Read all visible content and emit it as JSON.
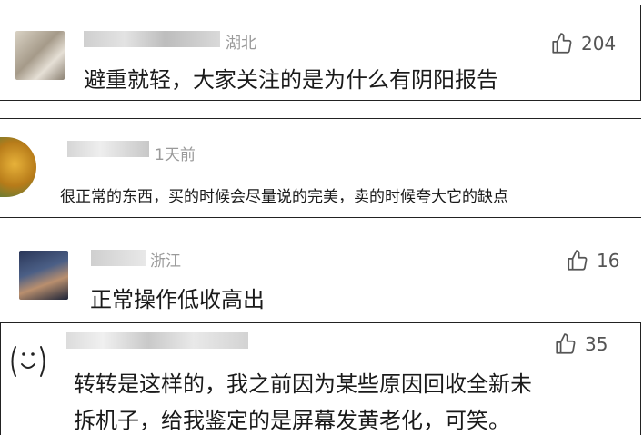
{
  "comments": [
    {
      "meta": "湖北",
      "likes": "204",
      "text": "避重就轻，大家关注的是为什么有阴阳报告"
    },
    {
      "meta": "1天前",
      "likes": "",
      "text": "很正常的东西，买的时候会尽量说的完美，卖的时候夸大它的缺点"
    },
    {
      "meta": "浙江",
      "likes": "16",
      "text": "正常操作低收高出"
    },
    {
      "meta": "",
      "likes": "35",
      "text_line1": "转转是这样的，我之前因为某些原因回收全新未",
      "text_line2": "拆机子，给我鉴定的是屏幕发黄老化，可笑。"
    }
  ],
  "icons": {
    "like": "thumbs-up-outline-icon"
  }
}
